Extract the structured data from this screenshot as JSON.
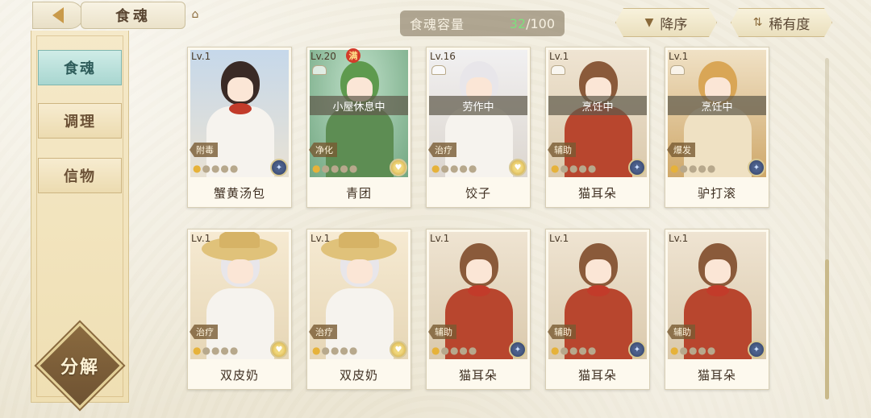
{
  "header": {
    "title": "食魂",
    "capacity_label": "食魂容量",
    "capacity_current": "32",
    "capacity_max": "/100"
  },
  "sort": {
    "order_label": "降序",
    "rarity_label": "稀有度"
  },
  "sidebar": {
    "tabs": [
      {
        "label": "食魂",
        "active": true
      },
      {
        "label": "调理",
        "active": false
      },
      {
        "label": "信物",
        "active": false
      }
    ],
    "decompose_label": "分解"
  },
  "cards": [
    {
      "level": "Lv.1",
      "name": "蟹黄汤包",
      "status": "",
      "role": "附毒",
      "stars": 1,
      "elem": "blue",
      "full": false
    },
    {
      "level": "Lv.20",
      "name": "青团",
      "status": "小屋休息中",
      "role": "净化",
      "stars": 1,
      "elem": "gold",
      "full": true,
      "full_label": "满"
    },
    {
      "level": "Lv.16",
      "name": "饺子",
      "status": "劳作中",
      "role": "治疗",
      "stars": 1,
      "elem": "gold",
      "full": false
    },
    {
      "level": "Lv.1",
      "name": "猫耳朵",
      "status": "烹饪中",
      "role": "辅助",
      "stars": 1,
      "elem": "blue",
      "full": false
    },
    {
      "level": "Lv.1",
      "name": "驴打滚",
      "status": "烹饪中",
      "role": "爆发",
      "stars": 1,
      "elem": "blue",
      "full": false
    },
    {
      "level": "Lv.1",
      "name": "双皮奶",
      "status": "",
      "role": "治疗",
      "stars": 1,
      "elem": "gold",
      "full": false
    },
    {
      "level": "Lv.1",
      "name": "双皮奶",
      "status": "",
      "role": "治疗",
      "stars": 1,
      "elem": "gold",
      "full": false
    },
    {
      "level": "Lv.1",
      "name": "猫耳朵",
      "status": "",
      "role": "辅助",
      "stars": 1,
      "elem": "blue",
      "full": false
    },
    {
      "level": "Lv.1",
      "name": "猫耳朵",
      "status": "",
      "role": "辅助",
      "stars": 1,
      "elem": "blue",
      "full": false
    },
    {
      "level": "Lv.1",
      "name": "猫耳朵",
      "status": "",
      "role": "辅助",
      "stars": 1,
      "elem": "blue",
      "full": false
    }
  ]
}
